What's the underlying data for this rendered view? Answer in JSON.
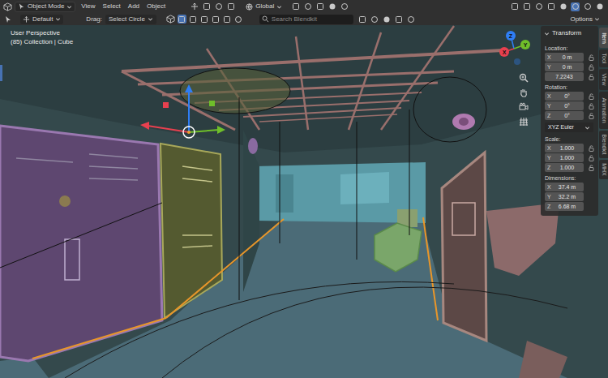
{
  "header": {
    "mode": "Object Mode",
    "menus": [
      "View",
      "Select",
      "Add",
      "Object"
    ],
    "orientation": "Global"
  },
  "tool_settings": {
    "pivot": "Default",
    "drag_label": "Drag:",
    "drag": "Select Circle",
    "search": {
      "placeholder": "Search Blendkit"
    },
    "options": "Options"
  },
  "viewport": {
    "view": "User Perspective",
    "context": "(85) Collection | Cube"
  },
  "gizmo": [
    {
      "label": "Z",
      "color": "#2f7ef5"
    },
    {
      "label": "Y",
      "color": "#6fbf2a"
    },
    {
      "label": "X",
      "color": "#e8404f"
    }
  ],
  "sidebar": {
    "tabs": [
      {
        "label": "Item",
        "selected": true
      },
      {
        "label": "Tool",
        "selected": false
      },
      {
        "label": "View",
        "selected": false
      },
      {
        "label": "Animation",
        "selected": false
      },
      {
        "label": "Blendkit",
        "selected": false
      },
      {
        "label": "MHX",
        "selected": false
      }
    ],
    "panel": {
      "title": "Transform",
      "sections": [
        {
          "label": "Location:",
          "locks": true,
          "fields": [
            {
              "axis": "X",
              "value": "0 m"
            },
            {
              "axis": "Y",
              "value": "0 m"
            },
            {
              "value": "7.2243"
            }
          ]
        },
        {
          "label": "Rotation:",
          "locks": true,
          "fields": [
            {
              "axis": "X",
              "value": "0°"
            },
            {
              "axis": "Y",
              "value": "0°"
            },
            {
              "axis": "Z",
              "value": "0°"
            }
          ],
          "mode": "XYZ Euler"
        },
        {
          "label": "Scale:",
          "locks": true,
          "fields": [
            {
              "axis": "X",
              "value": "1.000"
            },
            {
              "axis": "Y",
              "value": "1.000"
            },
            {
              "axis": "Z",
              "value": "1.000"
            }
          ]
        },
        {
          "label": "Dimensions:",
          "locks": false,
          "fields": [
            {
              "axis": "X",
              "value": "37.4 m"
            },
            {
              "axis": "Y",
              "value": "32.2 m"
            },
            {
              "axis": "Z",
              "value": "6.68 m"
            }
          ]
        }
      ]
    }
  }
}
